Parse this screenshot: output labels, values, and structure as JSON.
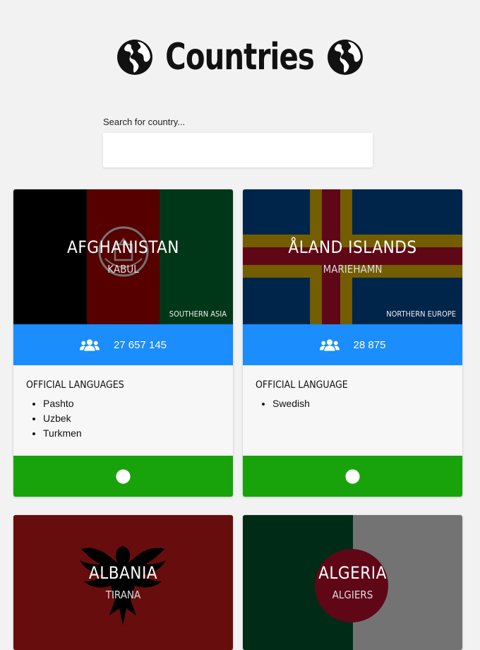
{
  "header": {
    "title": "Countries",
    "icon_left": "globe-icon",
    "icon_right": "globe-icon"
  },
  "search": {
    "label": "Search for country...",
    "value": "",
    "placeholder": ""
  },
  "countries": [
    {
      "name": "AFGHANISTAN",
      "capital": "KABUL",
      "region": "SOUTHERN ASIA",
      "population": "27 657 145",
      "languages_title": "OFFICIAL LANGUAGES",
      "languages": [
        "Pashto",
        "Uzbek",
        "Turkmen"
      ],
      "flag_colors": [
        "#000000",
        "#be0000",
        "#007a36"
      ]
    },
    {
      "name": "ÅLAND ISLANDS",
      "capital": "MARIEHAMN",
      "region": "NORTHERN EUROPE",
      "population": "28 875",
      "languages_title": "OFFICIAL LANGUAGE",
      "languages": [
        "Swedish"
      ],
      "flag_colors": [
        "#0053a5",
        "#ffce00",
        "#d21034"
      ]
    },
    {
      "name": "ALBANIA",
      "capital": "TIRANA",
      "flag_colors": [
        "#e41e20",
        "#000000"
      ]
    },
    {
      "name": "ALGERIA",
      "capital": "ALGIERS",
      "flag_colors": [
        "#006233",
        "#ffffff",
        "#d21034"
      ]
    }
  ],
  "colors": {
    "population_bar": "#1b8dfc",
    "link_bar": "#19a30a",
    "background": "#f2f2f2"
  }
}
